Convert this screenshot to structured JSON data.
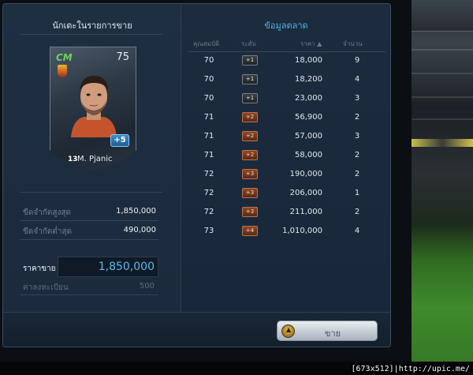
{
  "left_panel": {
    "title": "นักเตะในรายการขาย",
    "player": {
      "position": "CM",
      "overall": "75",
      "upgrade": "+5",
      "number": "13",
      "name": "M. Pjanic"
    },
    "max_price_label": "ขีดจำกัดสูงสุด",
    "max_price_value": "1,850,000",
    "min_price_label": "ขีดจำกัดต่ำสุด",
    "min_price_value": "490,000",
    "sell_price_label": "ราคาขาย",
    "sell_price_value": "1,850,000",
    "fee_label": "ค่าลงทะเบียน",
    "fee_value": "500"
  },
  "market": {
    "title": "ข้อมูลตลาด",
    "headers": {
      "overall": "คุณสมบัติ",
      "level": "ระดับ",
      "price": "ราคา ▲",
      "quantity": "จำนวน"
    },
    "rows": [
      {
        "overall": "70",
        "level": "+1",
        "price": "18,000",
        "quantity": "9"
      },
      {
        "overall": "70",
        "level": "+1",
        "price": "18,200",
        "quantity": "4"
      },
      {
        "overall": "70",
        "level": "+1",
        "price": "23,000",
        "quantity": "3"
      },
      {
        "overall": "71",
        "level": "+2",
        "price": "56,900",
        "quantity": "2"
      },
      {
        "overall": "71",
        "level": "+2",
        "price": "57,000",
        "quantity": "3"
      },
      {
        "overall": "71",
        "level": "+2",
        "price": "58,000",
        "quantity": "2"
      },
      {
        "overall": "72",
        "level": "+3",
        "price": "190,000",
        "quantity": "2"
      },
      {
        "overall": "72",
        "level": "+3",
        "price": "206,000",
        "quantity": "1"
      },
      {
        "overall": "72",
        "level": "+3",
        "price": "211,000",
        "quantity": "2"
      },
      {
        "overall": "73",
        "level": "+4",
        "price": "1,010,000",
        "quantity": "4"
      }
    ]
  },
  "footer": {
    "sell_button_label": "ขาย",
    "sell_button_icon": "upload-arrow-icon"
  },
  "watermark": "[673x512]|http://upic.me/",
  "colors": {
    "accent_blue": "#4fb6e8",
    "position_green": "#6fd05a",
    "level_bronze": "#8e4726"
  }
}
